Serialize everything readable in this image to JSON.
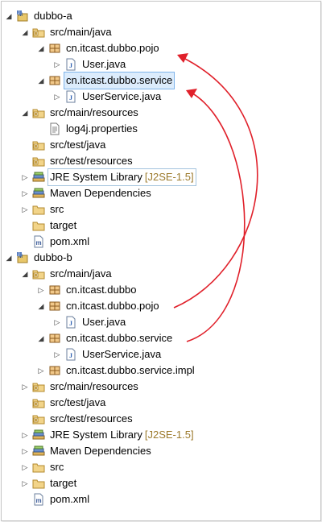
{
  "tree": {
    "project_a": {
      "name": "dubbo-a",
      "src_main_java": {
        "label": "src/main/java",
        "pojo": {
          "label": "cn.itcast.dubbo.pojo",
          "file": "User.java"
        },
        "service": {
          "label": "cn.itcast.dubbo.service",
          "file": "UserService.java"
        }
      },
      "src_main_resources": {
        "label": "src/main/resources",
        "file": "log4j.properties"
      },
      "src_test_java": "src/test/java",
      "src_test_resources": "src/test/resources",
      "jre": {
        "label": "JRE System Library",
        "decoration": "[J2SE-1.5]"
      },
      "maven": "Maven Dependencies",
      "src": "src",
      "target": "target",
      "pom": "pom.xml"
    },
    "project_b": {
      "name": "dubbo-b",
      "src_main_java": {
        "label": "src/main/java",
        "base_pkg": "cn.itcast.dubbo",
        "pojo": {
          "label": "cn.itcast.dubbo.pojo",
          "file": "User.java"
        },
        "service": {
          "label": "cn.itcast.dubbo.service",
          "file": "UserService.java"
        },
        "impl_pkg": "cn.itcast.dubbo.service.impl"
      },
      "src_main_resources": "src/main/resources",
      "src_test_java": "src/test/java",
      "src_test_resources": "src/test/resources",
      "jre": {
        "label": "JRE System Library",
        "decoration": "[J2SE-1.5]"
      },
      "maven": "Maven Dependencies",
      "src": "src",
      "target": "target",
      "pom": "pom.xml"
    }
  },
  "colors": {
    "arrow": "#e0202a",
    "selection_fill": "#dcecfc",
    "selection_border": "#7eb4ea",
    "decoration": "#9c7a2c"
  },
  "icons": {
    "project": "java-project-icon",
    "source_folder": "source-folder-icon",
    "package": "package-icon",
    "java_file": "java-file-icon",
    "properties_file": "properties-file-icon",
    "library": "library-icon",
    "folder": "folder-icon",
    "xml_file": "xml-file-icon"
  }
}
